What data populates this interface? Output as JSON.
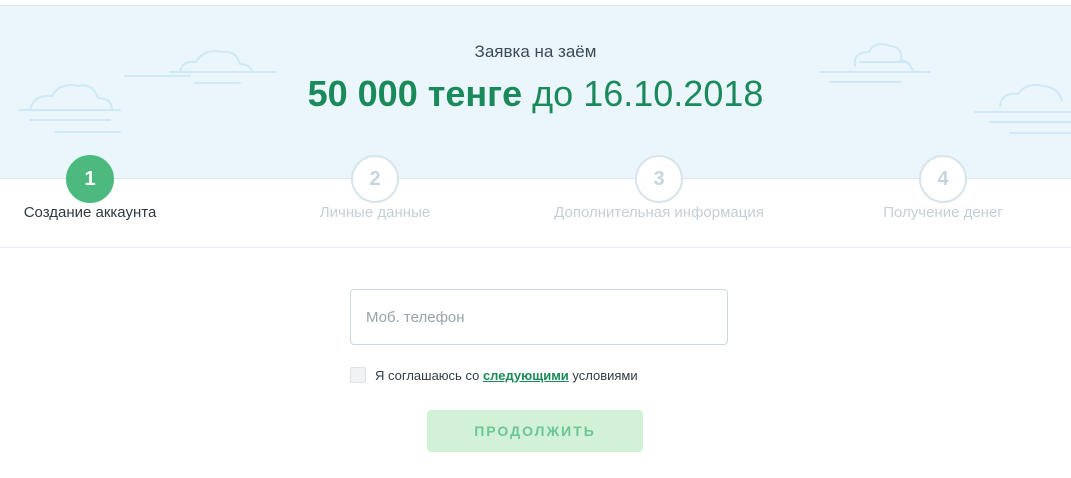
{
  "header": {
    "subtitle": "Заявка на заём",
    "amount": "50 000 тенге",
    "date_prefix": "до",
    "date": "16.10.2018"
  },
  "steps": [
    {
      "number": "1",
      "label": "Создание аккаунта",
      "state": "active"
    },
    {
      "number": "2",
      "label": "Личные данные",
      "state": "inactive"
    },
    {
      "number": "3",
      "label": "Дополнительная информация",
      "state": "inactive"
    },
    {
      "number": "4",
      "label": "Получение денег",
      "state": "inactive"
    }
  ],
  "form": {
    "phone_placeholder": "Моб. телефон",
    "phone_value": "",
    "agree_before": "Я соглашаюсь со ",
    "agree_link": "следующими",
    "agree_after": " условиями",
    "agree_checked": false,
    "continue_label": "ПРОДОЛЖИТЬ"
  },
  "colors": {
    "brand_green": "#1b8a5a",
    "active_step": "#4cba7e",
    "hero_bg": "#eaf6fc",
    "button_bg": "#d2f2d8",
    "button_text": "#6cc593"
  },
  "icons": {
    "background_decoration": "cloud-icon"
  }
}
